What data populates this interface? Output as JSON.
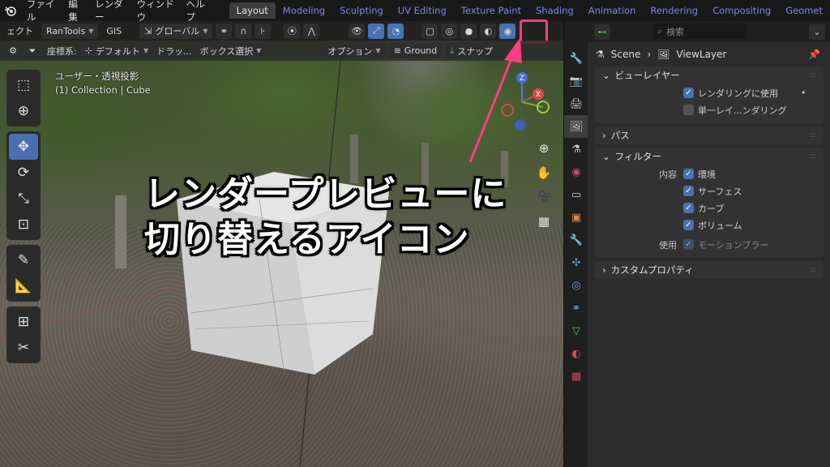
{
  "menu": [
    "ファイル",
    "編集",
    "レンダー",
    "ウィンドウ",
    "ヘルプ"
  ],
  "workspace_tabs": [
    {
      "label": "Layout",
      "active": true
    },
    {
      "label": "Modeling"
    },
    {
      "label": "Sculpting"
    },
    {
      "label": "UV Editing"
    },
    {
      "label": "Texture Paint"
    },
    {
      "label": "Shading"
    },
    {
      "label": "Animation"
    },
    {
      "label": "Rendering"
    },
    {
      "label": "Compositing"
    },
    {
      "label": "Geomet"
    }
  ],
  "viewport_header": {
    "object_menu": "ェクト",
    "ran_tools": "RanTools",
    "gis": "GIS",
    "transform_orientation": "グローバル",
    "coord_label": "座標系:",
    "coord_value": "デフォルト",
    "drag_label": "ドラッ...",
    "drag_value": "ボックス選択",
    "options": "オプション",
    "ground": "Ground",
    "snap": "スナップ"
  },
  "viewport_info": {
    "view_name": "ユーザー・透視投影",
    "collection": "(1) Collection | Cube"
  },
  "gizmo": {
    "z_label": "Z",
    "x_label": "X",
    "y_label": "Y"
  },
  "caption": {
    "line1": "レンダープレビューに",
    "line2": "切り替えるアイコン"
  },
  "properties": {
    "search_placeholder": "検索",
    "breadcrumb_scene": "Scene",
    "breadcrumb_layer": "ViewLayer",
    "panel_view_layer": "ビューレイヤー",
    "use_for_rendering": "レンダリングに使用",
    "single_layer": "単一レイ...ンダリング",
    "panel_passes": "パス",
    "panel_filter": "フィルター",
    "include_label": "内容",
    "env": "環境",
    "surfaces": "サーフェス",
    "curves": "カーブ",
    "volumes": "ボリューム",
    "use_label": "使用",
    "motion_blur": "モーションブラー",
    "panel_custom": "カスタムプロパティ"
  },
  "colors": {
    "accent": "#4772b3",
    "highlight": "#ff3d7f",
    "tab_blue": "#7a86e8"
  }
}
